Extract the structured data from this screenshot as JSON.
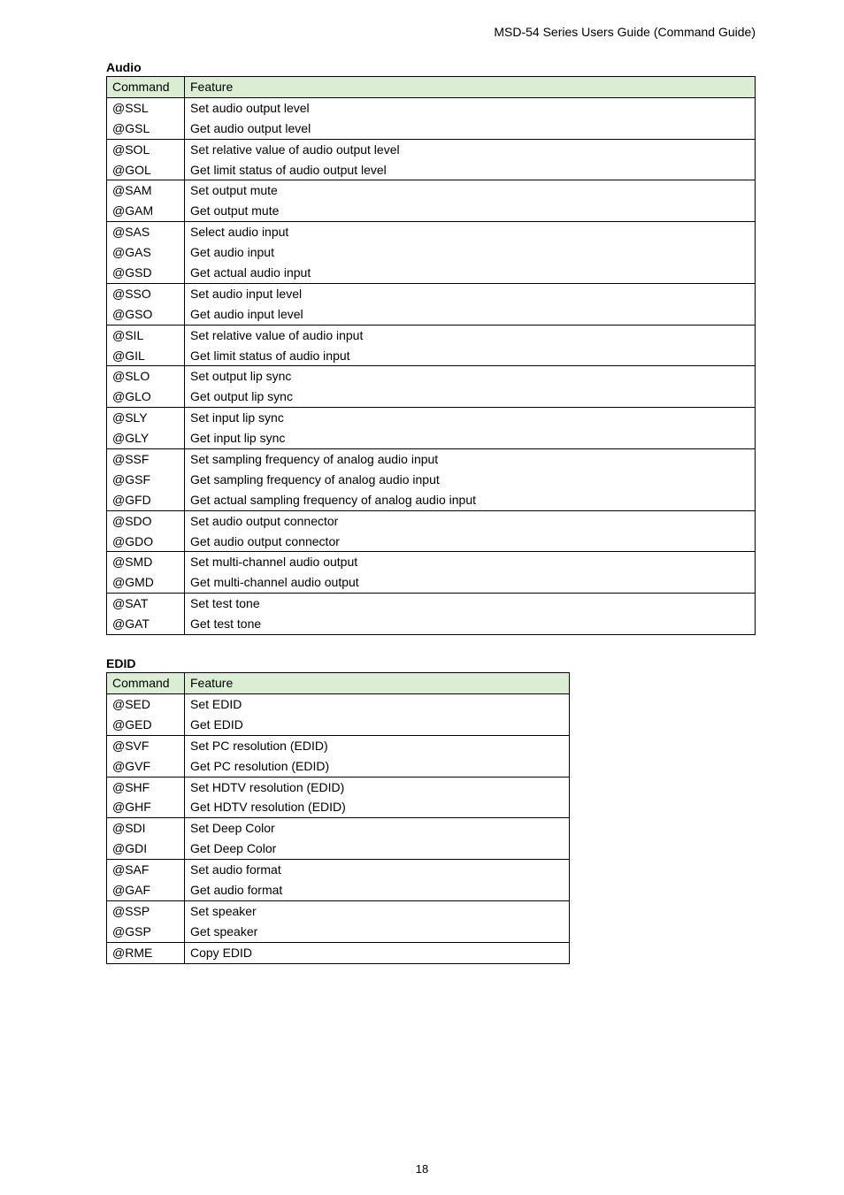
{
  "header": {
    "doc_title": "MSD-54 Series Users Guide (Command Guide)"
  },
  "audio": {
    "title": "Audio",
    "col_command": "Command",
    "col_feature": "Feature",
    "rows": [
      {
        "cmds": [
          "@SSL",
          "@GSL"
        ],
        "feats": [
          "Set audio output level",
          "Get audio output level"
        ],
        "dotted": true
      },
      {
        "cmds": [
          "@SOL",
          "@GOL"
        ],
        "feats": [
          "Set relative value of audio output level",
          "Get limit status of audio output level"
        ],
        "dotted": true
      },
      {
        "cmds": [
          "@SAM",
          "@GAM"
        ],
        "feats": [
          "Set output mute",
          "Get output mute"
        ],
        "dotted": true
      },
      {
        "cmds": [
          "@SAS",
          "@GAS",
          "@GSD"
        ],
        "feats": [
          "Select audio input",
          "Get audio input",
          "Get actual audio input"
        ],
        "dotted": true
      },
      {
        "cmds": [
          "@SSO",
          "@GSO"
        ],
        "feats": [
          "Set audio input level",
          "Get audio input level"
        ],
        "dotted": true
      },
      {
        "cmds": [
          "@SIL",
          "@GIL"
        ],
        "feats": [
          "Set relative value of audio input",
          "Get limit status of audio input"
        ],
        "dotted": true
      },
      {
        "cmds": [
          "@SLO",
          "@GLO"
        ],
        "feats": [
          "Set output lip sync",
          "Get output lip sync"
        ],
        "dotted": false
      },
      {
        "cmds": [
          "@SLY",
          "@GLY"
        ],
        "feats": [
          "Set input lip sync",
          "Get input lip sync"
        ],
        "dotted": true
      },
      {
        "cmds": [
          "@SSF",
          "@GSF",
          "@GFD"
        ],
        "feats": [
          "Set sampling frequency of analog audio input",
          "Get sampling frequency of analog audio input",
          "Get actual sampling frequency of analog audio input"
        ],
        "dotted": true
      },
      {
        "cmds": [
          "@SDO",
          "@GDO"
        ],
        "feats": [
          "Set audio output connector",
          "Get audio output connector"
        ],
        "dotted": true
      },
      {
        "cmds": [
          "@SMD",
          "@GMD"
        ],
        "feats": [
          "Set multi-channel audio output",
          "Get multi-channel audio output"
        ],
        "dotted": true
      },
      {
        "cmds": [
          "@SAT",
          "@GAT"
        ],
        "feats": [
          "Set test tone",
          "Get test tone"
        ],
        "dotted": true
      }
    ]
  },
  "edid": {
    "title": "EDID",
    "col_command": "Command",
    "col_feature": "Feature",
    "rows": [
      {
        "cmds": [
          "@SED",
          "@GED"
        ],
        "feats": [
          "Set EDID",
          "Get EDID"
        ],
        "dotted": true
      },
      {
        "cmds": [
          "@SVF",
          "@GVF"
        ],
        "feats": [
          "Set PC resolution (EDID)",
          "Get PC resolution (EDID)"
        ],
        "dotted": true
      },
      {
        "cmds": [
          "@SHF",
          "@GHF"
        ],
        "feats": [
          "Set HDTV resolution (EDID)",
          "Get HDTV resolution (EDID)"
        ],
        "dotted": true
      },
      {
        "cmds": [
          "@SDI",
          "@GDI"
        ],
        "feats": [
          "Set Deep Color",
          "Get Deep Color"
        ],
        "dotted": true
      },
      {
        "cmds": [
          "@SAF",
          "@GAF"
        ],
        "feats": [
          "Set audio format",
          "Get audio format"
        ],
        "dotted": true
      },
      {
        "cmds": [
          "@SSP",
          "@GSP"
        ],
        "feats": [
          "Set speaker",
          "Get speaker"
        ],
        "dotted": false
      },
      {
        "cmds": [
          "@RME"
        ],
        "feats": [
          "Copy EDID"
        ],
        "dotted": true
      }
    ]
  },
  "footer": {
    "page_number": "18"
  }
}
